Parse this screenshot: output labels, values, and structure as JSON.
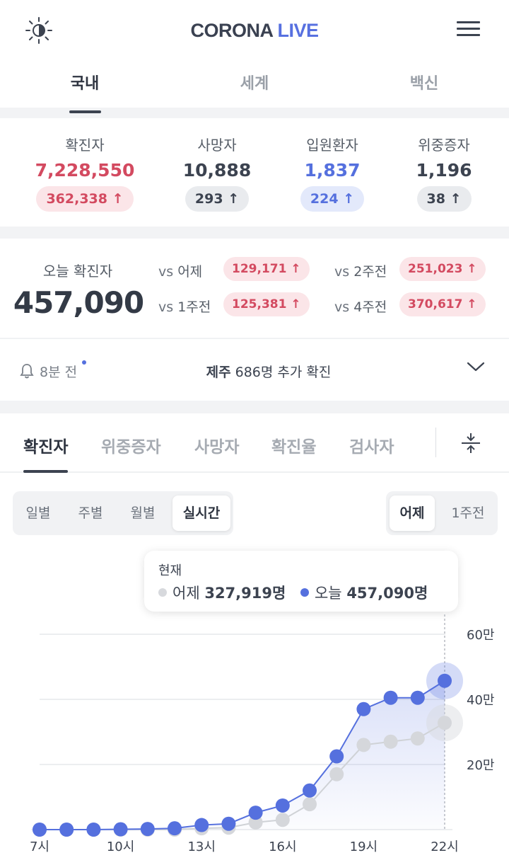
{
  "header": {
    "logo_part1": "CORONA",
    "logo_part2": "LIVE",
    "theme_icon": "brightness-icon",
    "menu_icon": "hamburger-menu-icon",
    "tabs": [
      {
        "label": "국내",
        "active": true
      },
      {
        "label": "세계",
        "active": false
      },
      {
        "label": "백신",
        "active": false
      }
    ]
  },
  "stats": [
    {
      "label": "확진자",
      "value": "7,228,550",
      "delta": "362,338",
      "color": "red"
    },
    {
      "label": "사망자",
      "value": "10,888",
      "delta": "293",
      "color": "dark"
    },
    {
      "label": "입원환자",
      "value": "1,837",
      "delta": "224",
      "color": "blue"
    },
    {
      "label": "위중증자",
      "value": "1,196",
      "delta": "38",
      "color": "dark"
    }
  ],
  "today": {
    "label": "오늘 확진자",
    "value": "457,090",
    "comparisons": [
      {
        "vs": "vs",
        "label": "어제",
        "delta": "129,171"
      },
      {
        "vs": "vs",
        "label": "2주전",
        "delta": "251,023"
      },
      {
        "vs": "vs",
        "label": "1주전",
        "delta": "125,381"
      },
      {
        "vs": "vs",
        "label": "4주전",
        "delta": "370,617"
      }
    ]
  },
  "alert": {
    "time": "8분 전",
    "region": "제주",
    "message": "686명 추가 확진"
  },
  "chart_tabs": [
    {
      "label": "확진자",
      "active": true
    },
    {
      "label": "위중증자",
      "active": false
    },
    {
      "label": "사망자",
      "active": false
    },
    {
      "label": "확진율",
      "active": false
    },
    {
      "label": "검사자",
      "active": false
    }
  ],
  "period_options": [
    {
      "label": "일별",
      "active": false
    },
    {
      "label": "주별",
      "active": false
    },
    {
      "label": "월별",
      "active": false
    },
    {
      "label": "실시간",
      "active": true
    }
  ],
  "compare_options": [
    {
      "label": "어제",
      "active": true
    },
    {
      "label": "1주전",
      "active": false
    }
  ],
  "tooltip": {
    "title": "현재",
    "yesterday_label": "어제",
    "yesterday_value": "327,919명",
    "today_label": "오늘",
    "today_value": "457,090명"
  },
  "chart_data": {
    "type": "line",
    "x": [
      "7시",
      "8시",
      "9시",
      "10시",
      "11시",
      "12시",
      "13시",
      "14시",
      "15시",
      "16시",
      "17시",
      "18시",
      "19시",
      "20시",
      "21시",
      "22시"
    ],
    "x_tick_labels": [
      "7시",
      "10시",
      "13시",
      "16시",
      "19시",
      "22시"
    ],
    "y_tick_labels": [
      "20만",
      "40만",
      "60만"
    ],
    "ylim": [
      0,
      600000
    ],
    "series": [
      {
        "name": "어제",
        "color": "#d7d9dd",
        "values": [
          0,
          0,
          0,
          0,
          0,
          0,
          4000,
          6000,
          22000,
          30000,
          78000,
          170000,
          260000,
          270000,
          280000,
          327919
        ]
      },
      {
        "name": "오늘",
        "color": "#5570de",
        "values": [
          0,
          0,
          0,
          1000,
          2000,
          4000,
          14000,
          18000,
          52000,
          74000,
          120000,
          225000,
          370000,
          405000,
          405000,
          457090
        ]
      }
    ],
    "grid": true
  }
}
